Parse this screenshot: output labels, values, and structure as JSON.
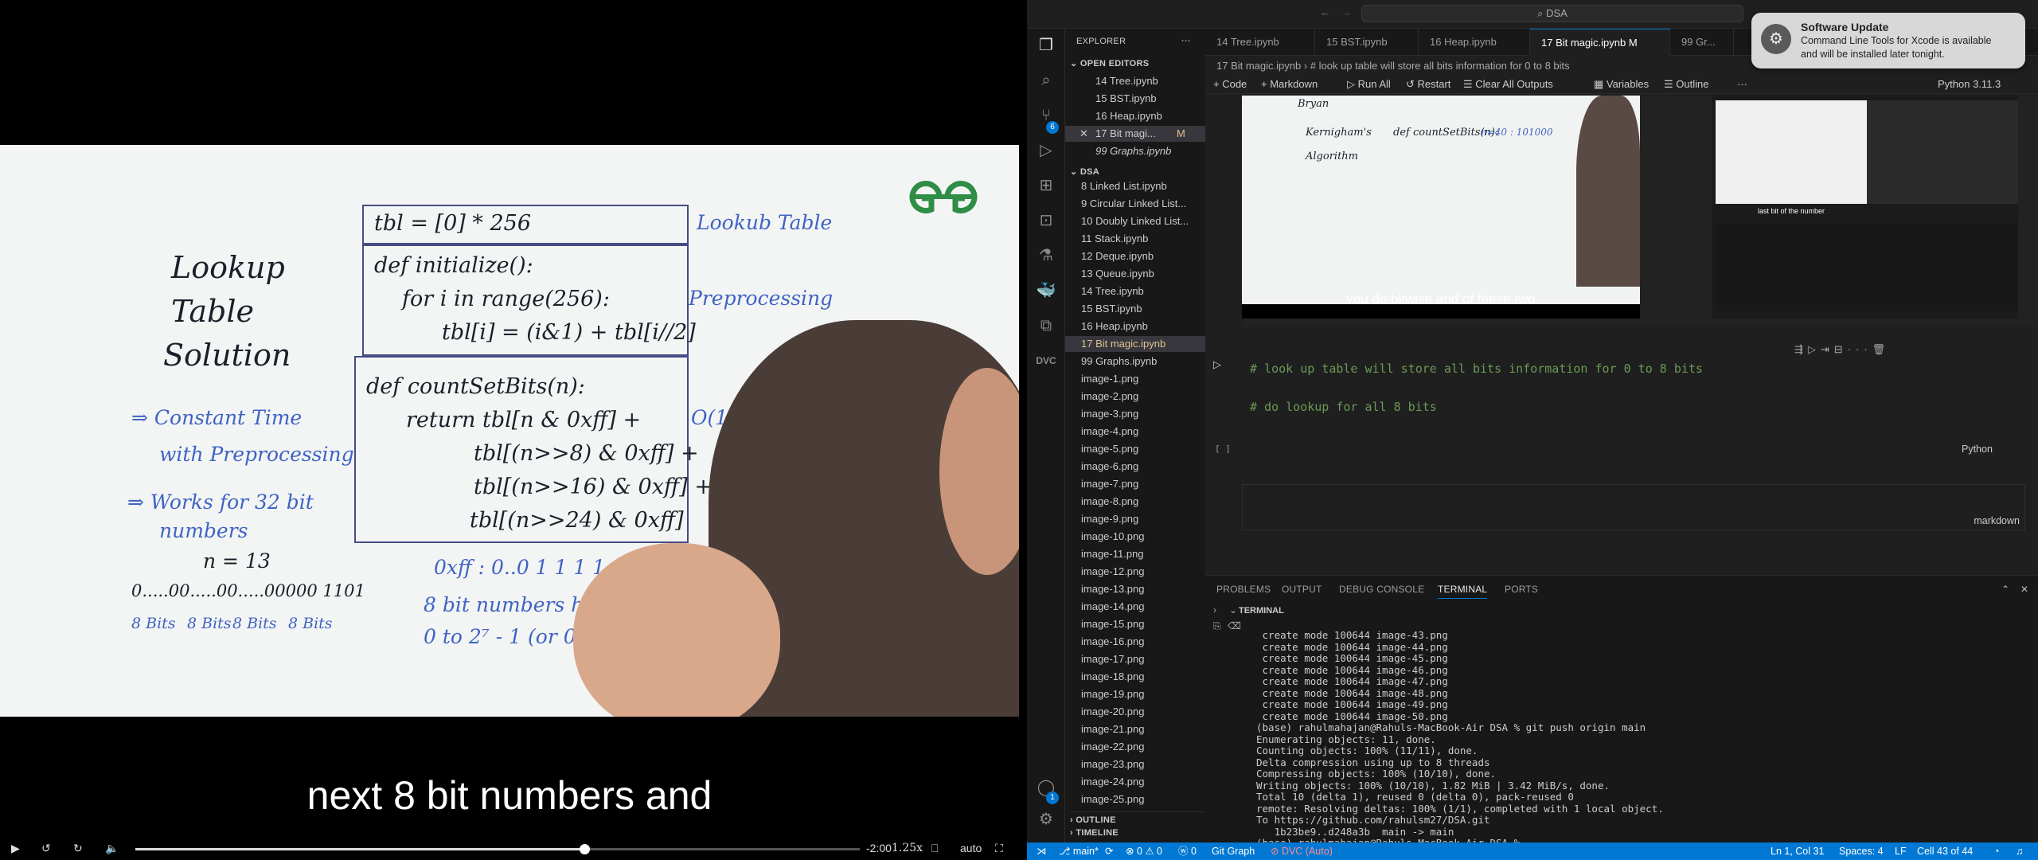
{
  "video": {
    "subtitle": "next 8 bit numbers and",
    "time_remaining": "-2:00",
    "speed": "1.25x",
    "quality": "auto",
    "progress": 0.62,
    "board": {
      "title_lines": [
        "Lookup",
        "Table",
        "Solution"
      ],
      "point1_a": "⇒ Constant Time",
      "point1_b": "with Preprocessing",
      "point2_a": "⇒ Works for 32 bit",
      "point2_b": "numbers",
      "n_eq": "n = 13",
      "bits": "0.....00.....00.....00000 1101",
      "bits_labels": [
        "8 Bits",
        "8 Bits",
        "8 Bits",
        "8 Bits"
      ],
      "tbl_line": "tbl = [0] * 256",
      "init_lines": [
        "def initialize():",
        "for i in range(256):",
        "tbl[i] = (i&1) + tbl[i//2]"
      ],
      "count_lines": [
        "def countSetBits(n):",
        "return tbl[n & 0xff] +",
        "tbl[(n>>8) & 0xff] +",
        "tbl[(n>>16) & 0xff] +",
        "tbl[(n>>24) & 0xff]"
      ],
      "label_lookup": "Lookub Table",
      "label_pre": "Preprocessing",
      "label_o1": "O(1) function",
      "hex_line": "0xff : 0..0 1 1 1 1 1 1 1 1",
      "note_a": "8 bit numbers have values from",
      "note_b": "0 to 2⁷ - 1 (or 0 to 255)"
    }
  },
  "vscode": {
    "search": "DSA",
    "explorer_title": "EXPLORER",
    "open_editors_title": "OPEN EDITORS",
    "open_editors": [
      {
        "name": "14 Tree.ipynb",
        "mod": ""
      },
      {
        "name": "15 BST.ipynb",
        "mod": ""
      },
      {
        "name": "16 Heap.ipynb",
        "mod": ""
      },
      {
        "name": "17 Bit magi...",
        "mod": "M"
      },
      {
        "name": "99 Graphs.ipynb",
        "mod": ""
      }
    ],
    "folder_title": "DSA",
    "files": [
      "8 Linked List.ipynb",
      "9 Circular Linked List...",
      "10 Doubly Linked List...",
      "11 Stack.ipynb",
      "12 Deque.ipynb",
      "13 Queue.ipynb",
      "14 Tree.ipynb",
      "15 BST.ipynb",
      "16 Heap.ipynb",
      "17 Bit magic.ipynb",
      "99 Graphs.ipynb",
      "image-1.png",
      "image-2.png",
      "image-3.png",
      "image-4.png",
      "image-5.png",
      "image-6.png",
      "image-7.png",
      "image-8.png",
      "image-9.png",
      "image-10.png",
      "image-11.png",
      "image-12.png",
      "image-13.png",
      "image-14.png",
      "image-15.png",
      "image-16.png",
      "image-17.png",
      "image-18.png",
      "image-19.png",
      "image-20.png",
      "image-21.png",
      "image-22.png",
      "image-23.png",
      "image-24.png",
      "image-25.png"
    ],
    "outline": "OUTLINE",
    "timeline": "TIMELINE",
    "tabs": [
      {
        "label": "14 Tree.ipynb",
        "active": false
      },
      {
        "label": "15 BST.ipynb",
        "active": false
      },
      {
        "label": "16 Heap.ipynb",
        "active": false
      },
      {
        "label": "17 Bit magic.ipynb  M",
        "active": true
      },
      {
        "label": "99 Gr...",
        "active": false
      }
    ],
    "breadcrumb": "17 Bit magic.ipynb  ›  # look up table will store all bits information for 0 to 8 bits",
    "toolbar": [
      "+ Code",
      "+ Markdown",
      "▷ Run All",
      "↺ Restart",
      "☰ Clear All Outputs",
      "▦ Variables",
      "☰ Outline",
      "···"
    ],
    "kernel": "Python 3.11.3",
    "thumb_caption": "you do bitwise and of these two",
    "screenshot_caption": "last bit of the number",
    "code_lines": [
      "# look up table will store all bits information for 0 to 8 bits",
      "",
      "# do lookup for all 8 bits"
    ],
    "cell_exec": "[ ]",
    "cell_lang": "Python",
    "md_lang": "markdown",
    "panel_tabs": [
      "PROBLEMS",
      "OUTPUT",
      "DEBUG CONSOLE",
      "TERMINAL",
      "PORTS"
    ],
    "terminal_title": "TERMINAL",
    "terminal_lines": [
      " create mode 100644 image-43.png",
      " create mode 100644 image-44.png",
      " create mode 100644 image-45.png",
      " create mode 100644 image-46.png",
      " create mode 100644 image-47.png",
      " create mode 100644 image-48.png",
      " create mode 100644 image-49.png",
      " create mode 100644 image-50.png",
      "(base) rahulmahajan@Rahuls-MacBook-Air DSA % git push origin main",
      "Enumerating objects: 11, done.",
      "Counting objects: 100% (11/11), done.",
      "Delta compression using up to 8 threads",
      "Compressing objects: 100% (10/10), done.",
      "Writing objects: 100% (10/10), 1.82 MiB | 3.42 MiB/s, done.",
      "Total 10 (delta 1), reused 0 (delta 0), pack-reused 0",
      "remote: Resolving deltas: 100% (1/1), completed with 1 local object.",
      "To https://github.com/rahulsm27/DSA.git",
      "   1b23be9..d248a3b  main -> main",
      "(base) rahulmahajan@Rahuls-MacBook-Air DSA % "
    ],
    "status_left": [
      "⎇ main*",
      "⟳",
      "⊗ 0 ⚠ 0",
      "ⓦ 0",
      "Git Graph",
      "⊘ DVC (Auto)"
    ],
    "status_right": [
      "Ln 1, Col 31",
      "Spaces: 4",
      "LF",
      "Cell 43 of 44"
    ],
    "activity_badge_scm": "6",
    "activity_badge_account": "1"
  },
  "notification": {
    "title": "Software Update",
    "body_a": "Command Line Tools for Xcode is available",
    "body_b": "and will be installed later tonight."
  }
}
